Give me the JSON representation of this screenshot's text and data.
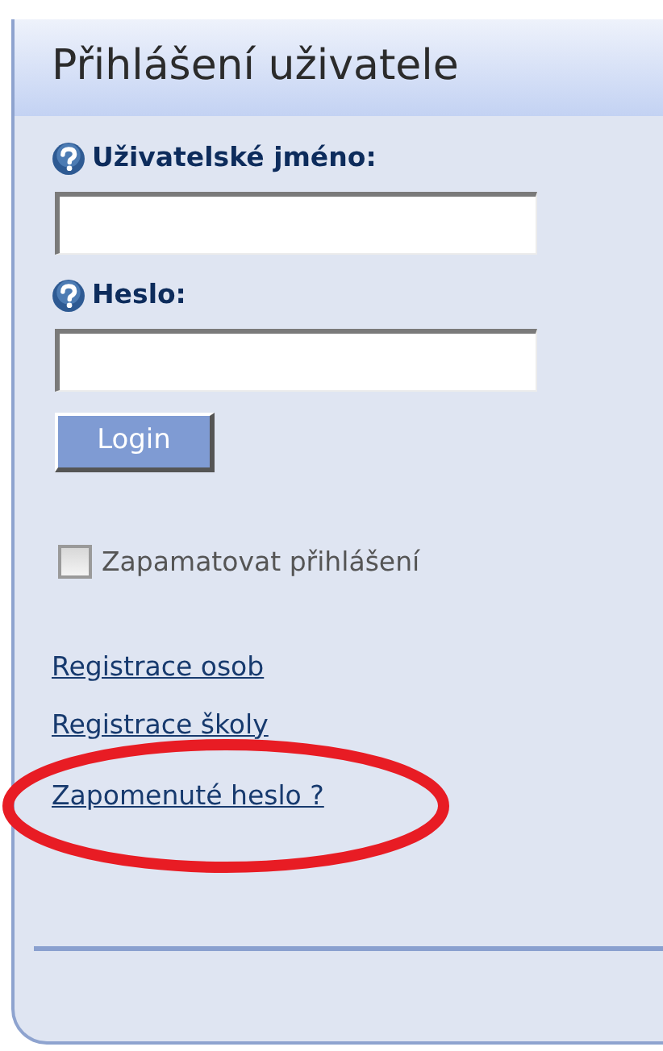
{
  "panel": {
    "title": "Přihlášení uživatele"
  },
  "fields": [
    {
      "label": "Uživatelské jméno:"
    },
    {
      "label": "Heslo:"
    }
  ],
  "login_button": "Login",
  "remember": {
    "label": "Zapamatovat přihlášení",
    "checked": false
  },
  "links": [
    {
      "label": "Registrace osob",
      "highlighted": false
    },
    {
      "label": "Registrace školy",
      "highlighted": false
    },
    {
      "label": "Zapomenuté heslo ?",
      "highlighted": true
    }
  ]
}
